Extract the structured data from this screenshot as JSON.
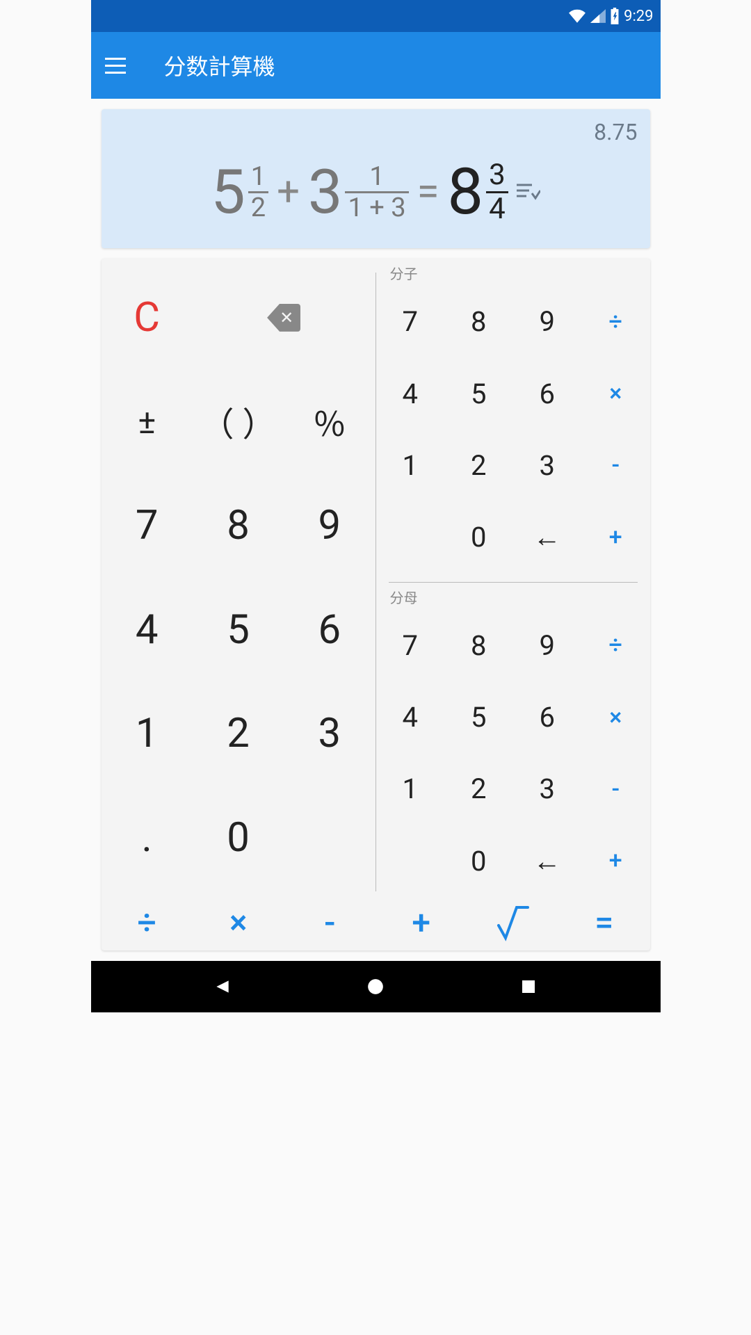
{
  "status": {
    "time": "9:29"
  },
  "toolbar": {
    "title": "分数計算機"
  },
  "display": {
    "decimal": "8.75",
    "term1": {
      "whole": "5",
      "num": "1",
      "den": "2"
    },
    "op1": "+",
    "term2": {
      "whole": "3",
      "num": "1",
      "den": "1 + 3"
    },
    "eq": "=",
    "result": {
      "whole": "8",
      "num": "3",
      "den": "4"
    }
  },
  "keys": {
    "clear": "C",
    "sign": "±",
    "paren": "（ ）",
    "percent": "％",
    "seven": "7",
    "eight": "8",
    "nine": "9",
    "four": "4",
    "five": "5",
    "six": "6",
    "one": "1",
    "two": "2",
    "three": "3",
    "zero": "0",
    "dot": "."
  },
  "mini": {
    "label_num": "分子",
    "label_den": "分母",
    "seven": "7",
    "eight": "8",
    "nine": "9",
    "div": "÷",
    "four": "4",
    "five": "5",
    "six": "6",
    "mul": "×",
    "one": "1",
    "two": "2",
    "three": "3",
    "minus": "-",
    "zero": "0",
    "back": "←",
    "plus": "+"
  },
  "bottom": {
    "div": "÷",
    "mul": "×",
    "minus": "-",
    "plus": "+",
    "sqrt": "√",
    "eq": "="
  }
}
